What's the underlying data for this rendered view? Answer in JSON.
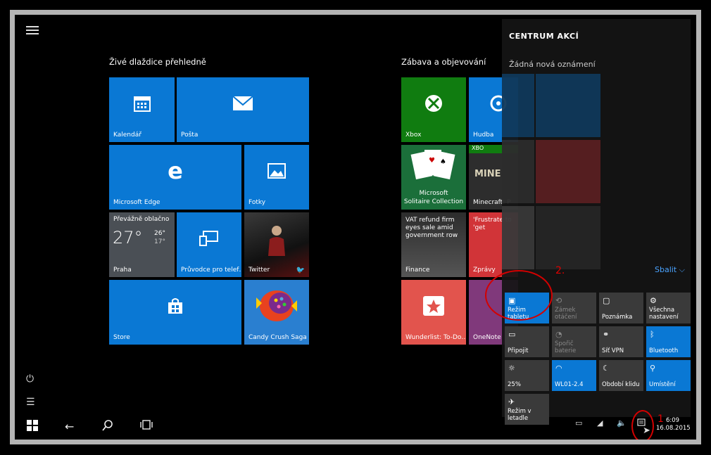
{
  "start": {
    "group1_title": "Živé dlaždice přehledně",
    "group2_title": "Zábava a objevování",
    "tiles": {
      "kalendar": "Kalendář",
      "posta": "Pošta",
      "edge": "Microsoft Edge",
      "fotky": "Fotky",
      "weather": {
        "condition": "Převážně oblačno",
        "temp": "27°",
        "high": "26°",
        "low": "17°",
        "city": "Praha"
      },
      "pruvodce": "Průvodce pro telef…",
      "twitter": "Twitter",
      "store": "Store",
      "candy": "Candy Crush Saga",
      "xbox": "Xbox",
      "hudba": "Hudba",
      "solitaire_line1": "Microsoft",
      "solitaire_line2": "Solitaire Collection",
      "minecraft": "Minecraft: P",
      "xbox_badge": "XBO",
      "finance_news": "VAT refund firm eyes sale amid government row",
      "finance": "Finance",
      "zpravy_news": "'Frustrate to 'get",
      "zpravy": "Zprávy",
      "wunderlist": "Wunderlist: To-Do…",
      "onenote": "OneNote"
    }
  },
  "action_center": {
    "title": "CENTRUM AKCÍ",
    "no_notifications": "Žádná nová oznámení",
    "collapse": "Sbalit",
    "quick_actions": [
      {
        "label": "Režim tabletu",
        "icon": "tablet-mode-icon",
        "on": true
      },
      {
        "label": "Zámek otáčení",
        "icon": "rotation-lock-icon",
        "on": false
      },
      {
        "label": "Poznámka",
        "icon": "note-icon",
        "on": false
      },
      {
        "label": "Všechna nastavení",
        "icon": "settings-icon",
        "on": false
      },
      {
        "label": "Připojit",
        "icon": "connect-icon",
        "on": false
      },
      {
        "label": "Spořič baterie",
        "icon": "battery-saver-icon",
        "on": false
      },
      {
        "label": "Síť VPN",
        "icon": "vpn-icon",
        "on": false
      },
      {
        "label": "Bluetooth",
        "icon": "bluetooth-icon",
        "on": true
      },
      {
        "label": "25%",
        "icon": "brightness-icon",
        "on": false
      },
      {
        "label": "WL01-2.4",
        "icon": "wifi-icon",
        "on": true
      },
      {
        "label": "Období klidu",
        "icon": "quiet-hours-icon",
        "on": false
      },
      {
        "label": "Umístění",
        "icon": "location-icon",
        "on": true
      },
      {
        "label": "Režim v letadle",
        "icon": "airplane-icon",
        "on": false
      }
    ]
  },
  "annotations": {
    "marker1": "1",
    "marker2": "2."
  },
  "taskbar": {
    "time": "6:09",
    "date": "16.08.2015"
  },
  "colors": {
    "tile_blue": "#0a78d4",
    "annotation_red": "#d40000"
  }
}
